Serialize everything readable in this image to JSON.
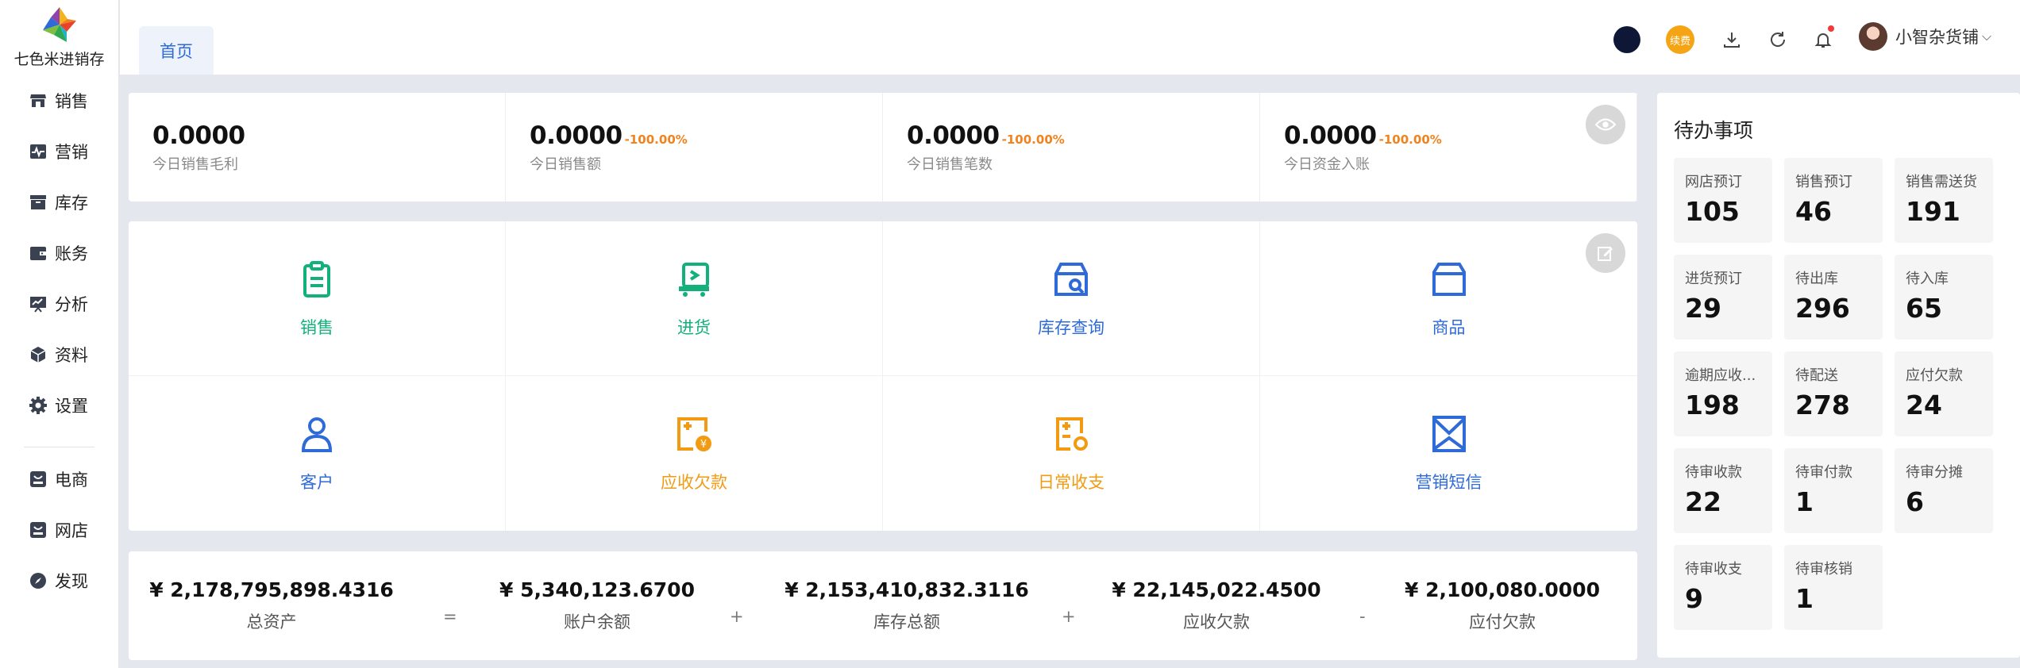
{
  "brand": {
    "name": "七色米进销存"
  },
  "sidebar": {
    "items": [
      {
        "label": "销售",
        "icon": "store-icon"
      },
      {
        "label": "营销",
        "icon": "pulse-icon"
      },
      {
        "label": "库存",
        "icon": "box-icon"
      },
      {
        "label": "账务",
        "icon": "wallet-icon"
      },
      {
        "label": "分析",
        "icon": "chart-board-icon"
      },
      {
        "label": "资料",
        "icon": "cube-icon"
      },
      {
        "label": "设置",
        "icon": "gear-icon"
      }
    ],
    "extra_items": [
      {
        "label": "电商",
        "icon": "ecommerce-icon"
      },
      {
        "label": "网店",
        "icon": "web-store-icon"
      },
      {
        "label": "发现",
        "icon": "compass-icon"
      }
    ]
  },
  "topbar": {
    "tab": "首页",
    "renew_label": "续费",
    "user_name": "小智杂货铺"
  },
  "stats": [
    {
      "value": "0.0000",
      "change": "",
      "label": "今日销售毛利"
    },
    {
      "value": "0.0000",
      "change": "-100.00%",
      "label": "今日销售额"
    },
    {
      "value": "0.0000",
      "change": "-100.00%",
      "label": "今日销售笔数"
    },
    {
      "value": "0.0000",
      "change": "-100.00%",
      "label": "今日资金入账"
    }
  ],
  "shortcuts": [
    {
      "label": "销售",
      "icon": "clipboard-icon",
      "color": "#12b07a"
    },
    {
      "label": "进货",
      "icon": "truck-icon",
      "color": "#12b07a"
    },
    {
      "label": "库存查询",
      "icon": "warehouse-search-icon",
      "color": "#2e6ad8"
    },
    {
      "label": "商品",
      "icon": "package-icon",
      "color": "#2e6ad8"
    },
    {
      "label": "客户",
      "icon": "person-icon",
      "color": "#2e6ad8"
    },
    {
      "label": "应收欠款",
      "icon": "receivable-icon",
      "color": "#f29b12"
    },
    {
      "label": "日常收支",
      "icon": "ledger-icon",
      "color": "#f29b12"
    },
    {
      "label": "营销短信",
      "icon": "envelope-icon",
      "color": "#2e6ad8"
    }
  ],
  "summary": {
    "items": [
      {
        "value": "¥ 2,178,795,898.4316",
        "label": "总资产"
      },
      {
        "value": "¥ 5,340,123.6700",
        "label": "账户余额"
      },
      {
        "value": "¥ 2,153,410,832.3116",
        "label": "库存总额"
      },
      {
        "value": "¥ 22,145,022.4500",
        "label": "应收欠款"
      },
      {
        "value": "¥ 2,100,080.0000",
        "label": "应付欠款"
      }
    ],
    "operators": [
      "=",
      "+",
      "+",
      "-"
    ]
  },
  "todo": {
    "title": "待办事项",
    "items": [
      {
        "name": "网店预订",
        "count": "105"
      },
      {
        "name": "销售预订",
        "count": "46"
      },
      {
        "name": "销售需送货",
        "count": "191"
      },
      {
        "name": "进货预订",
        "count": "29"
      },
      {
        "name": "待出库",
        "count": "296"
      },
      {
        "name": "待入库",
        "count": "65"
      },
      {
        "name": "逾期应收...",
        "count": "198"
      },
      {
        "name": "待配送",
        "count": "278"
      },
      {
        "name": "应付欠款",
        "count": "24"
      },
      {
        "name": "待审收款",
        "count": "22"
      },
      {
        "name": "待审付款",
        "count": "1"
      },
      {
        "name": "待审分摊",
        "count": "6"
      },
      {
        "name": "待审收支",
        "count": "9"
      },
      {
        "name": "待审核销",
        "count": "1"
      }
    ]
  },
  "colors": {
    "primary": "#2e6ad8",
    "green": "#12b07a",
    "orange": "#f29b12",
    "danger_pct": "#f0831e"
  }
}
